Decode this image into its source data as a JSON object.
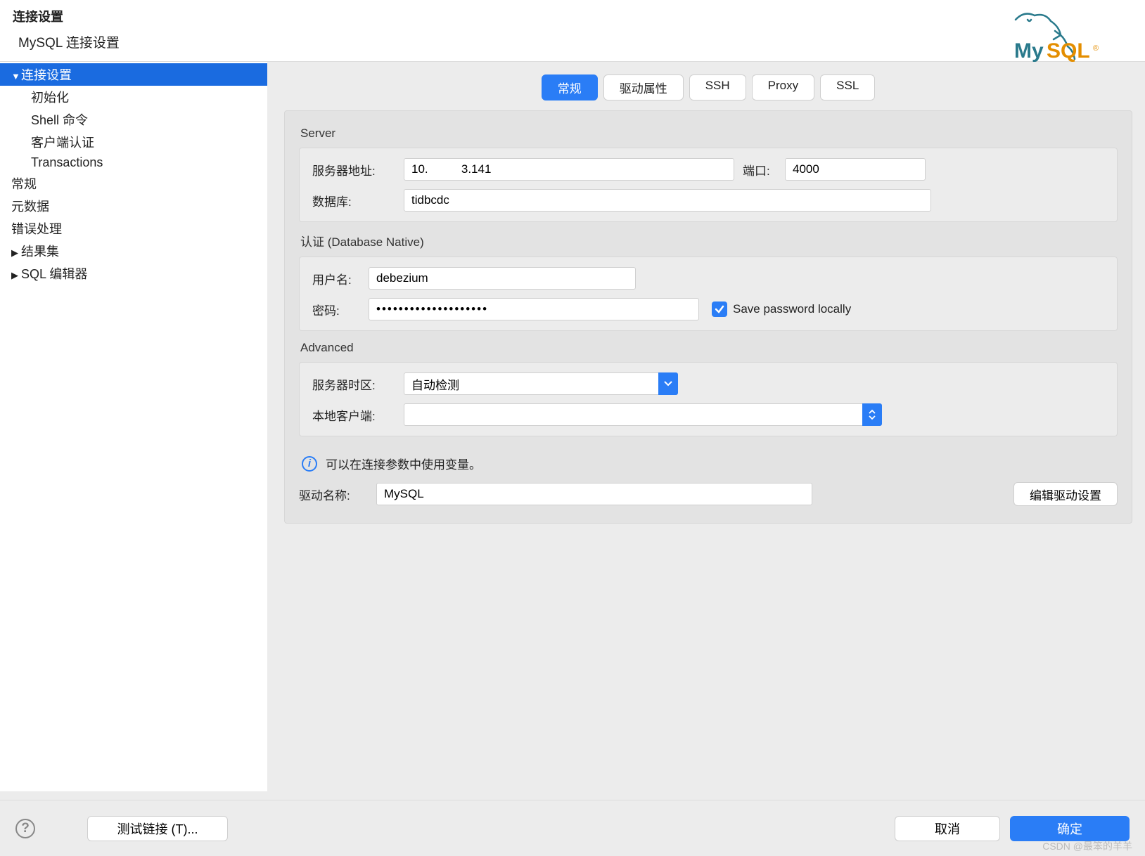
{
  "header": {
    "title": "连接设置",
    "subtitle": "MySQL 连接设置",
    "logo_text": "MySQL"
  },
  "sidebar": {
    "items": [
      {
        "label": "连接设置",
        "expanded": true,
        "selected": true
      },
      {
        "label": "初始化",
        "child": true
      },
      {
        "label": "Shell 命令",
        "child": true
      },
      {
        "label": "客户端认证",
        "child": true
      },
      {
        "label": "Transactions",
        "child": true
      },
      {
        "label": "常规"
      },
      {
        "label": "元数据"
      },
      {
        "label": "错误处理"
      },
      {
        "label": "结果集",
        "hasChildren": true
      },
      {
        "label": "SQL 编辑器",
        "hasChildren": true
      }
    ]
  },
  "tabs": [
    "常规",
    "驱动属性",
    "SSH",
    "Proxy",
    "SSL"
  ],
  "form": {
    "server_section": "Server",
    "server_label": "服务器地址:",
    "server_value": "10.          3.141",
    "port_label": "端口:",
    "port_value": "4000",
    "db_label": "数据库:",
    "db_value": "tidbcdc",
    "auth_section": "认证 (Database Native)",
    "user_label": "用户名:",
    "user_value": "debezium",
    "pwd_label": "密码:",
    "pwd_value": "••••••••••••••••••••",
    "save_pwd": "Save password locally",
    "advanced_section": "Advanced",
    "tz_label": "服务器时区:",
    "tz_value": "自动检测",
    "local_label": "本地客户端:",
    "local_value": "",
    "info_text": "可以在连接参数中使用变量。",
    "driver_label": "驱动名称:",
    "driver_value": "MySQL",
    "edit_driver": "编辑驱动设置"
  },
  "footer": {
    "test": "测试链接 (T)...",
    "cancel": "取消",
    "ok": "确定"
  },
  "watermark": "CSDN @最笨的羊羊"
}
